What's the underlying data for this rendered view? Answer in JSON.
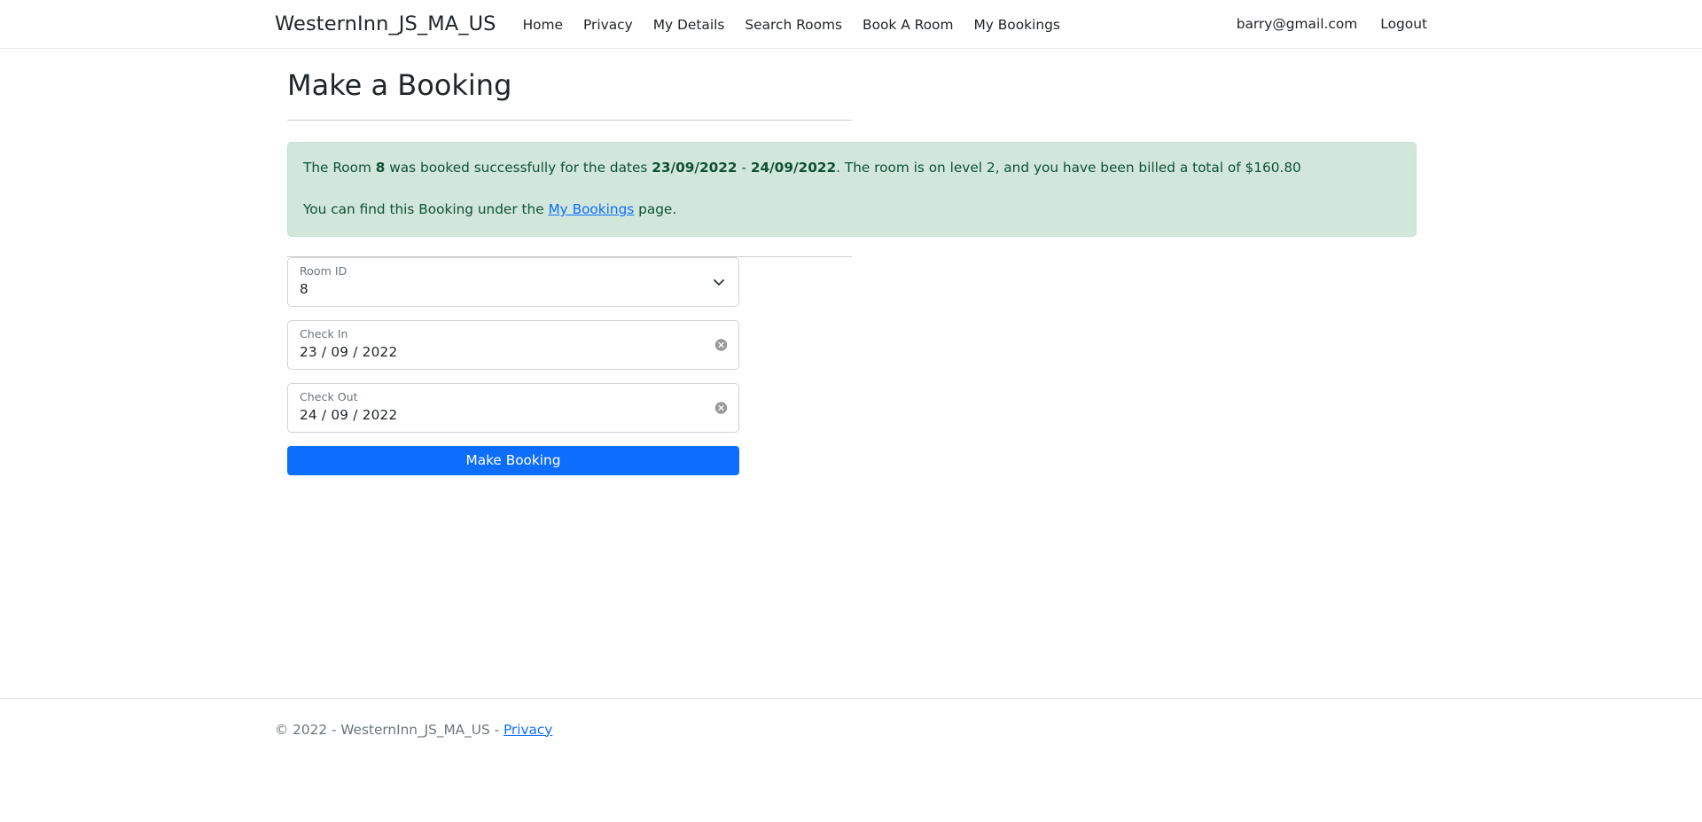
{
  "navbar": {
    "brand": "WesternInn_JS_MA_US",
    "links": [
      {
        "label": "Home"
      },
      {
        "label": "Privacy"
      },
      {
        "label": "My Details"
      },
      {
        "label": "Search Rooms"
      },
      {
        "label": "Book A Room"
      },
      {
        "label": "My Bookings"
      }
    ],
    "user_email": "barry@gmail.com",
    "logout_label": "Logout"
  },
  "main": {
    "page_title": "Make a Booking",
    "alert": {
      "type": "success",
      "background_color": "#d2e7dc",
      "text_color": "#0f5132",
      "line1": {
        "part1": "The Room ",
        "room_id": "8",
        "part2": " was booked successfully for the dates ",
        "check_in": "23/09/2022",
        "separator": " - ",
        "check_out": "24/09/2022",
        "part3": ". The room is on level 2, and you have been billed a total of $160.80"
      },
      "line2": {
        "part1": "You can find this Booking under the ",
        "link_label": "My Bookings",
        "part2": " page."
      }
    },
    "form": {
      "room_id": {
        "label": "Room ID",
        "value": "8",
        "icon": "chevron-down-icon"
      },
      "check_in": {
        "label": "Check In",
        "value": "23 / 09 / 2022",
        "placeholder": "dd / mm / yyyy",
        "icon": "clear-circle-icon"
      },
      "check_out": {
        "label": "Check Out",
        "value": "24 / 09 / 2022",
        "placeholder": "dd / mm / yyyy",
        "icon": "clear-circle-icon"
      },
      "submit_label": "Make Booking",
      "submit_color": "#0d6efd"
    }
  },
  "footer": {
    "copyright": "© 2022 - WesternInn_JS_MA_US - ",
    "privacy_label": "Privacy"
  }
}
